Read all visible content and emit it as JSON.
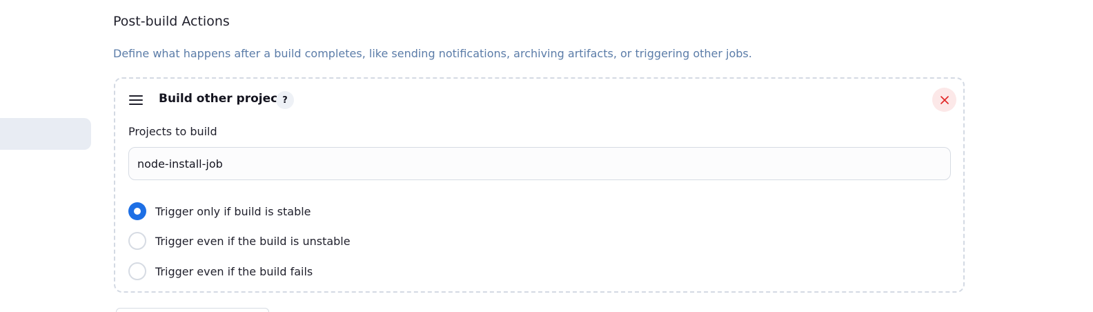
{
  "section": {
    "title": "Post-build Actions",
    "description": "Define what happens after a build completes, like sending notifications, archiving artifacts, or triggering other jobs."
  },
  "card": {
    "title": "Build other projects",
    "help_label": "?",
    "drag_icon": "drag-handle-icon",
    "close_icon": "close-icon",
    "close_color": "#e02424",
    "projects_field": {
      "label": "Projects to build",
      "value": "node-install-job"
    },
    "trigger_options": [
      {
        "label": "Trigger only if build is stable",
        "selected": true
      },
      {
        "label": "Trigger even if the build is unstable",
        "selected": false
      },
      {
        "label": "Trigger even if the build fails",
        "selected": false
      }
    ]
  },
  "colors": {
    "accent": "#1d6fe5",
    "description": "#5b7ca8",
    "dashed_border": "#d3d9e3",
    "close_bg": "#fce8e8"
  }
}
